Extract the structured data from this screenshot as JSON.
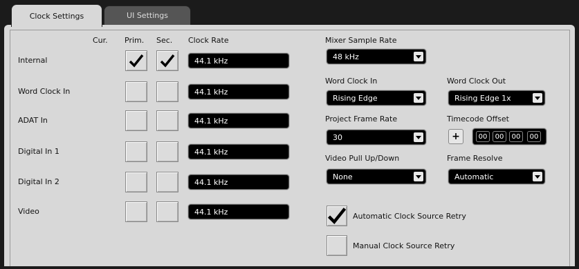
{
  "tabs": [
    {
      "label": "Clock Settings",
      "active": true
    },
    {
      "label": "UI Settings",
      "active": false
    }
  ],
  "source_table": {
    "headers": {
      "current": "Cur.",
      "primary": "Prim.",
      "secondary": "Sec.",
      "clock_rate": "Clock Rate"
    },
    "rows": [
      {
        "label": "Internal",
        "primary": true,
        "secondary": true,
        "rate": "44.1 kHz"
      },
      {
        "label": "Word Clock In",
        "primary": false,
        "secondary": false,
        "rate": "44.1 kHz"
      },
      {
        "label": "ADAT In",
        "primary": false,
        "secondary": false,
        "rate": "44.1 kHz"
      },
      {
        "label": "Digital In 1",
        "primary": false,
        "secondary": false,
        "rate": "44.1 kHz"
      },
      {
        "label": "Digital In 2",
        "primary": false,
        "secondary": false,
        "rate": "44.1 kHz"
      },
      {
        "label": "Video",
        "primary": false,
        "secondary": false,
        "rate": "44.1 kHz"
      }
    ]
  },
  "mixer_sample_rate": {
    "label": "Mixer Sample Rate",
    "value": "48 kHz"
  },
  "word_clock_in": {
    "label": "Word Clock In",
    "value": "Rising Edge"
  },
  "word_clock_out": {
    "label": "Word Clock Out",
    "value": "Rising Edge 1x"
  },
  "project_frame_rate": {
    "label": "Project Frame Rate",
    "value": "30"
  },
  "timecode_offset": {
    "label": "Timecode Offset",
    "sign": "+",
    "fields": [
      "00",
      "00",
      "00",
      "00"
    ]
  },
  "video_pull": {
    "label": "Video Pull Up/Down",
    "value": "None"
  },
  "frame_resolve": {
    "label": "Frame Resolve",
    "value": "Automatic"
  },
  "auto_retry": {
    "label": "Automatic Clock Source Retry",
    "checked": true
  },
  "manual_retry": {
    "label": "Manual Clock Source Retry",
    "checked": false
  }
}
